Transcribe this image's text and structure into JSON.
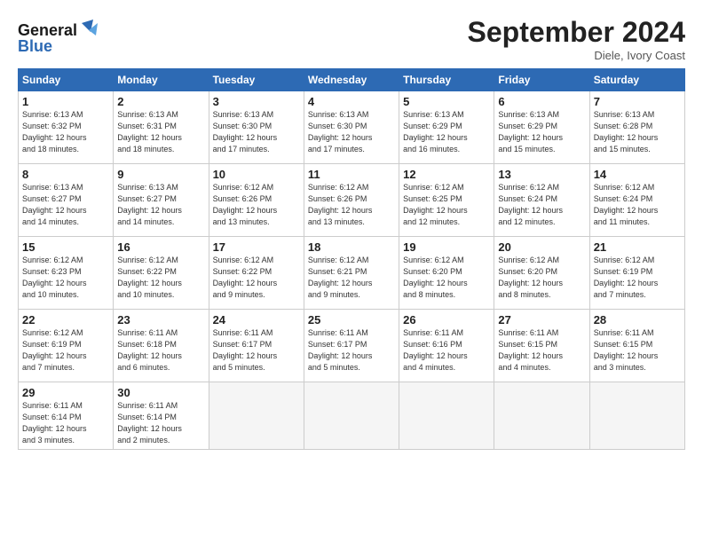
{
  "logo": {
    "line1": "General",
    "line2": "Blue"
  },
  "title": "September 2024",
  "location": "Diele, Ivory Coast",
  "days_header": [
    "Sunday",
    "Monday",
    "Tuesday",
    "Wednesday",
    "Thursday",
    "Friday",
    "Saturday"
  ],
  "weeks": [
    [
      {
        "num": "1",
        "info": "Sunrise: 6:13 AM\nSunset: 6:32 PM\nDaylight: 12 hours\nand 18 minutes."
      },
      {
        "num": "2",
        "info": "Sunrise: 6:13 AM\nSunset: 6:31 PM\nDaylight: 12 hours\nand 18 minutes."
      },
      {
        "num": "3",
        "info": "Sunrise: 6:13 AM\nSunset: 6:30 PM\nDaylight: 12 hours\nand 17 minutes."
      },
      {
        "num": "4",
        "info": "Sunrise: 6:13 AM\nSunset: 6:30 PM\nDaylight: 12 hours\nand 17 minutes."
      },
      {
        "num": "5",
        "info": "Sunrise: 6:13 AM\nSunset: 6:29 PM\nDaylight: 12 hours\nand 16 minutes."
      },
      {
        "num": "6",
        "info": "Sunrise: 6:13 AM\nSunset: 6:29 PM\nDaylight: 12 hours\nand 15 minutes."
      },
      {
        "num": "7",
        "info": "Sunrise: 6:13 AM\nSunset: 6:28 PM\nDaylight: 12 hours\nand 15 minutes."
      }
    ],
    [
      {
        "num": "8",
        "info": "Sunrise: 6:13 AM\nSunset: 6:27 PM\nDaylight: 12 hours\nand 14 minutes."
      },
      {
        "num": "9",
        "info": "Sunrise: 6:13 AM\nSunset: 6:27 PM\nDaylight: 12 hours\nand 14 minutes."
      },
      {
        "num": "10",
        "info": "Sunrise: 6:12 AM\nSunset: 6:26 PM\nDaylight: 12 hours\nand 13 minutes."
      },
      {
        "num": "11",
        "info": "Sunrise: 6:12 AM\nSunset: 6:26 PM\nDaylight: 12 hours\nand 13 minutes."
      },
      {
        "num": "12",
        "info": "Sunrise: 6:12 AM\nSunset: 6:25 PM\nDaylight: 12 hours\nand 12 minutes."
      },
      {
        "num": "13",
        "info": "Sunrise: 6:12 AM\nSunset: 6:24 PM\nDaylight: 12 hours\nand 12 minutes."
      },
      {
        "num": "14",
        "info": "Sunrise: 6:12 AM\nSunset: 6:24 PM\nDaylight: 12 hours\nand 11 minutes."
      }
    ],
    [
      {
        "num": "15",
        "info": "Sunrise: 6:12 AM\nSunset: 6:23 PM\nDaylight: 12 hours\nand 10 minutes."
      },
      {
        "num": "16",
        "info": "Sunrise: 6:12 AM\nSunset: 6:22 PM\nDaylight: 12 hours\nand 10 minutes."
      },
      {
        "num": "17",
        "info": "Sunrise: 6:12 AM\nSunset: 6:22 PM\nDaylight: 12 hours\nand 9 minutes."
      },
      {
        "num": "18",
        "info": "Sunrise: 6:12 AM\nSunset: 6:21 PM\nDaylight: 12 hours\nand 9 minutes."
      },
      {
        "num": "19",
        "info": "Sunrise: 6:12 AM\nSunset: 6:20 PM\nDaylight: 12 hours\nand 8 minutes."
      },
      {
        "num": "20",
        "info": "Sunrise: 6:12 AM\nSunset: 6:20 PM\nDaylight: 12 hours\nand 8 minutes."
      },
      {
        "num": "21",
        "info": "Sunrise: 6:12 AM\nSunset: 6:19 PM\nDaylight: 12 hours\nand 7 minutes."
      }
    ],
    [
      {
        "num": "22",
        "info": "Sunrise: 6:12 AM\nSunset: 6:19 PM\nDaylight: 12 hours\nand 7 minutes."
      },
      {
        "num": "23",
        "info": "Sunrise: 6:11 AM\nSunset: 6:18 PM\nDaylight: 12 hours\nand 6 minutes."
      },
      {
        "num": "24",
        "info": "Sunrise: 6:11 AM\nSunset: 6:17 PM\nDaylight: 12 hours\nand 5 minutes."
      },
      {
        "num": "25",
        "info": "Sunrise: 6:11 AM\nSunset: 6:17 PM\nDaylight: 12 hours\nand 5 minutes."
      },
      {
        "num": "26",
        "info": "Sunrise: 6:11 AM\nSunset: 6:16 PM\nDaylight: 12 hours\nand 4 minutes."
      },
      {
        "num": "27",
        "info": "Sunrise: 6:11 AM\nSunset: 6:15 PM\nDaylight: 12 hours\nand 4 minutes."
      },
      {
        "num": "28",
        "info": "Sunrise: 6:11 AM\nSunset: 6:15 PM\nDaylight: 12 hours\nand 3 minutes."
      }
    ],
    [
      {
        "num": "29",
        "info": "Sunrise: 6:11 AM\nSunset: 6:14 PM\nDaylight: 12 hours\nand 3 minutes."
      },
      {
        "num": "30",
        "info": "Sunrise: 6:11 AM\nSunset: 6:14 PM\nDaylight: 12 hours\nand 2 minutes."
      },
      {
        "num": "",
        "info": ""
      },
      {
        "num": "",
        "info": ""
      },
      {
        "num": "",
        "info": ""
      },
      {
        "num": "",
        "info": ""
      },
      {
        "num": "",
        "info": ""
      }
    ]
  ]
}
